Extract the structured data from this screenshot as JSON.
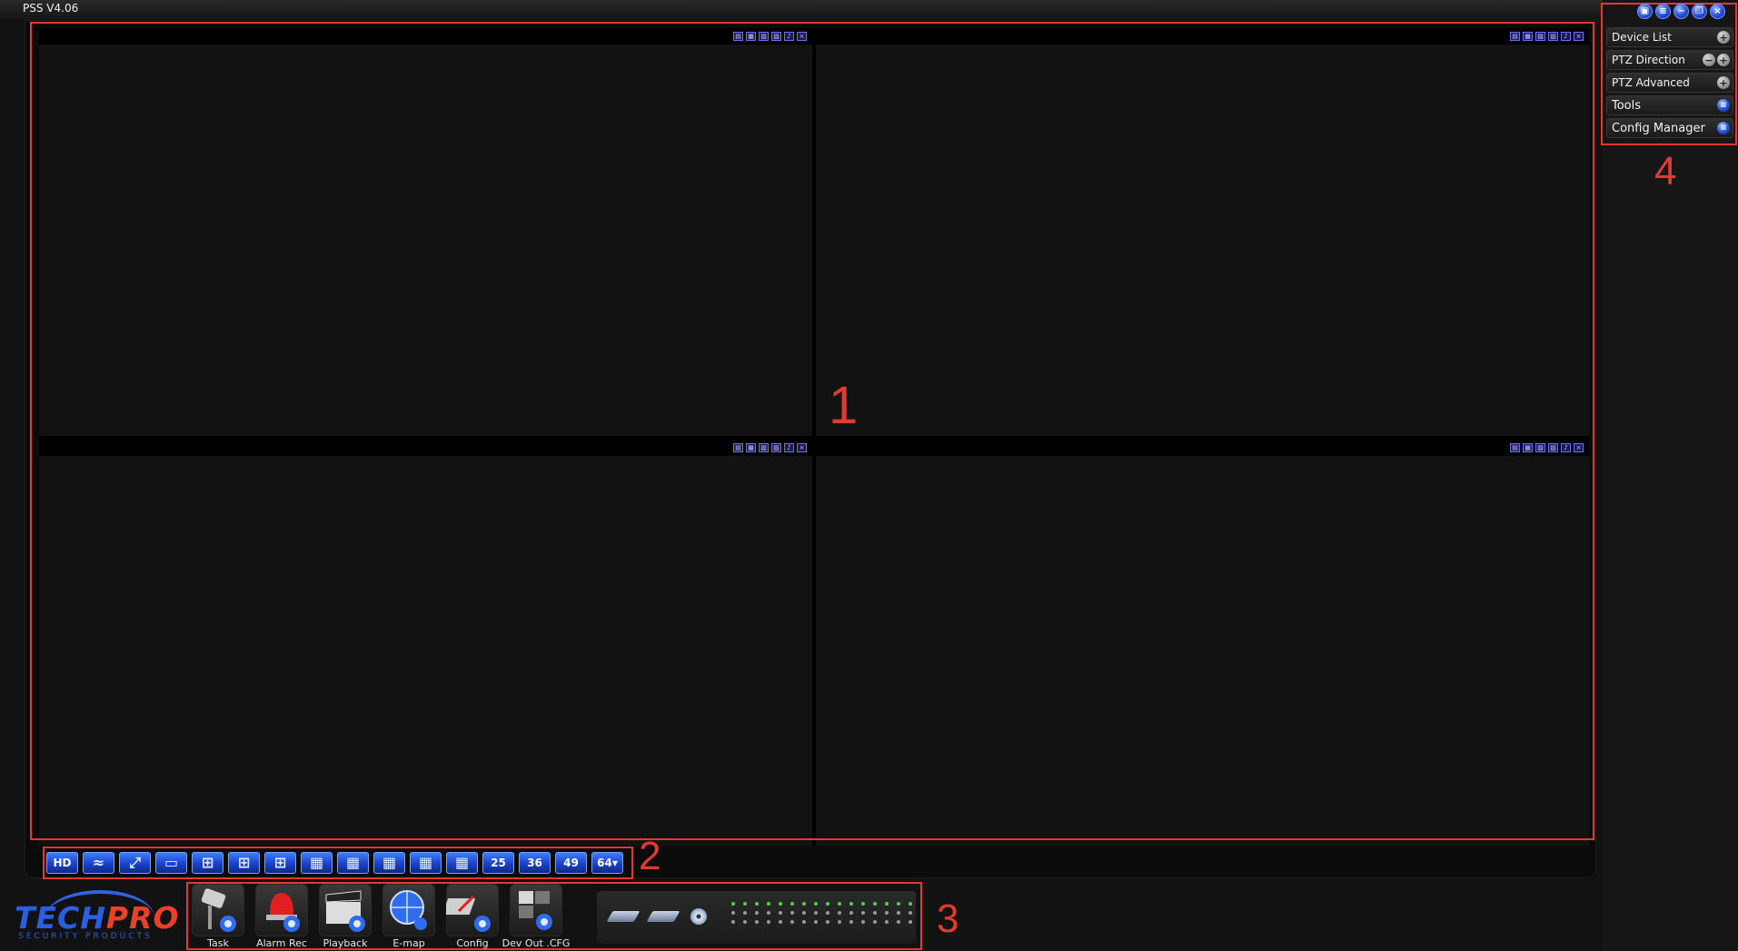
{
  "app": {
    "title": "PSS  V4.06"
  },
  "window_controls": [
    {
      "name": "lock-icon",
      "glyph": "▣"
    },
    {
      "name": "list-icon",
      "glyph": "≡"
    },
    {
      "name": "minimize-icon",
      "glyph": "−"
    },
    {
      "name": "restore-icon",
      "glyph": "❐"
    },
    {
      "name": "close-icon",
      "glyph": "×"
    }
  ],
  "annotations": [
    "1",
    "2",
    "3",
    "4"
  ],
  "video_cell_toolbar": [
    {
      "name": "snapshot-icon",
      "glyph": "▤"
    },
    {
      "name": "record-icon",
      "glyph": "▦"
    },
    {
      "name": "zoom-icon",
      "glyph": "▧"
    },
    {
      "name": "color-adjust-icon",
      "glyph": "▨"
    },
    {
      "name": "audio-icon",
      "glyph": "♪"
    },
    {
      "name": "close-icon",
      "glyph": "×"
    }
  ],
  "layout_bar": [
    {
      "name": "hd-button",
      "text": "HD"
    },
    {
      "name": "fluency-button",
      "icon": "wave-icon",
      "glyph": "≈"
    },
    {
      "name": "fullscreen-button",
      "icon": "fullscreen-icon",
      "glyph": "⤢"
    },
    {
      "name": "layout-1-button",
      "icon": "layout-1-icon",
      "glyph": "▭"
    },
    {
      "name": "layout-4-button",
      "icon": "layout-4-icon",
      "glyph": "⊞"
    },
    {
      "name": "layout-6-button",
      "icon": "layout-6-icon",
      "glyph": "⊞"
    },
    {
      "name": "layout-8-button",
      "icon": "layout-8-icon",
      "glyph": "⊞"
    },
    {
      "name": "layout-9-button",
      "icon": "layout-9-icon",
      "glyph": "▦"
    },
    {
      "name": "layout-13-button",
      "icon": "layout-13-icon",
      "glyph": "▦"
    },
    {
      "name": "layout-16-button",
      "icon": "layout-16-icon",
      "glyph": "▦"
    },
    {
      "name": "layout-20-button",
      "icon": "layout-20-icon",
      "glyph": "▦"
    },
    {
      "name": "layout-20b-button",
      "icon": "layout-grid-icon",
      "glyph": "▦"
    },
    {
      "name": "layout-25-button",
      "text": "25"
    },
    {
      "name": "layout-36-button",
      "text": "36"
    },
    {
      "name": "layout-49-button",
      "text": "49"
    },
    {
      "name": "layout-64-button",
      "text": "64▾"
    }
  ],
  "logo": {
    "brand_a": "TECH",
    "brand_b": "PRO",
    "tagline": "SECURITY PRODUCTS"
  },
  "function_bar": [
    {
      "name": "task-button",
      "label": "Task",
      "icon": "camera-eye-icon"
    },
    {
      "name": "alarm-rec-button",
      "label": "Alarm Rec",
      "icon": "alarm-siren-icon"
    },
    {
      "name": "playback-button",
      "label": "Playback",
      "icon": "clapperboard-icon"
    },
    {
      "name": "emap-button",
      "label": "E-map",
      "icon": "globe-icon"
    },
    {
      "name": "config-button",
      "label": "Config",
      "icon": "config-gear-icon"
    },
    {
      "name": "dev-out-cfg-button",
      "label": "Dev Out .CFG",
      "icon": "device-gear-icon"
    }
  ],
  "status": {
    "dots_on": 16,
    "dots_total": 48
  },
  "menu": [
    {
      "name": "device-list",
      "label": "Device List",
      "big": false,
      "controls": [
        "plus"
      ]
    },
    {
      "name": "ptz-direction",
      "label": "PTZ Direction",
      "big": false,
      "controls": [
        "minus",
        "plus"
      ]
    },
    {
      "name": "ptz-advanced",
      "label": "PTZ Advanced",
      "big": false,
      "controls": [
        "plus"
      ]
    },
    {
      "name": "tools",
      "label": "Tools",
      "big": true,
      "controls": [
        "blue"
      ]
    },
    {
      "name": "config-manager",
      "label": "Config Manager",
      "big": true,
      "controls": [
        "blue"
      ]
    }
  ],
  "colors": {
    "accent_blue": "#2450d8",
    "annotation_red": "#e5382f",
    "status_green": "#47d83b"
  }
}
